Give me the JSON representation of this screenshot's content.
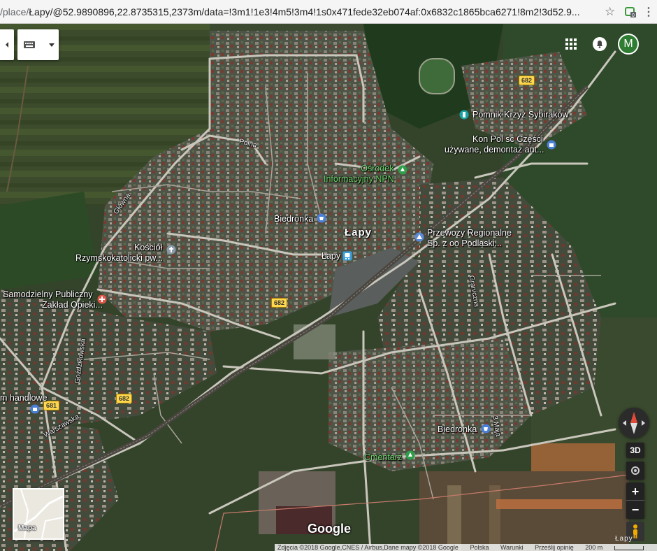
{
  "browser": {
    "url_prefix": "/place/",
    "url_path": "Łapy/@52.9890896,22.8735315,2373m/data=!3m1!1e3!4m5!3m4!1s0x471fede32eb074af:0x6832c1865bca6271!8m2!3d52.9..."
  },
  "top_controls": {
    "account_initial": "M"
  },
  "labels": {
    "polna": "Polna",
    "glowna": "Główna",
    "osrodek_1": "Ośrodek",
    "osrodek_2": "Informacyjny NPN",
    "pomnik": "Pomnik Krzyż Sybiraków",
    "konpol_1": "Kon Pol sc Części",
    "konpol_2": "używane, demontaż aut...",
    "biedronka_1": "Biedronka",
    "lapy_city": "Łapy",
    "przewozy_1": "Przewozy Regionalne",
    "przewozy_2": "Sp. z oo Podlaski...",
    "lapy_station": "Łapy",
    "kosciol_1": "Kościół",
    "kosciol_2": "Rzymskokatolicki pw...",
    "samodzielny_1": "Samodzielny Publiczny",
    "samodzielny_2": "Zakład Opieki...",
    "graniczna": "Graniczna",
    "gozdzikowska": "Goździkowska",
    "handlowe": "m handlowe",
    "warszawska": "Warszawska",
    "biedronka_2": "Biedronka",
    "maja": "3 Maja",
    "cmentarz": "Cmentarz",
    "google": "Google",
    "corner_mark": "Łapy"
  },
  "road_shields": {
    "r682_a": "682",
    "r682_b": "682",
    "r682_c": "682",
    "r681": "681"
  },
  "map_controls": {
    "threed": "3D",
    "zoom_in": "+",
    "zoom_out": "−",
    "minimap_label": "Mapa"
  },
  "attribution": {
    "imagery": "Zdjęcia ©2018 Google,CNES / Airbus,Dane mapy ©2018 Google",
    "country": "Polska",
    "terms": "Warunki",
    "feedback": "Prześlij opinię",
    "scale": "200 m"
  }
}
